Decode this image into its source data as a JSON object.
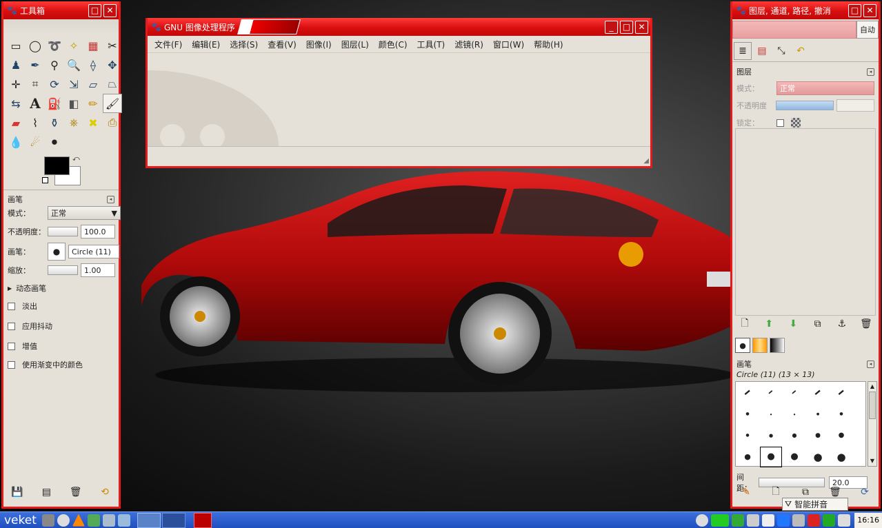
{
  "toolbox": {
    "title": "工具箱",
    "tools": [
      "rect-select",
      "ellipse-select",
      "free-select",
      "fuzzy-select",
      "color-select",
      "scissors",
      "foreground-select",
      "paths",
      "color-picker",
      "zoom",
      "measure",
      "move",
      "align",
      "crop",
      "rotate",
      "scale",
      "shear",
      "perspective",
      "flip",
      "text",
      "bucket-fill",
      "blend",
      "pencil",
      "paintbrush",
      "eraser",
      "airbrush",
      "ink",
      "clone",
      "heal",
      "perspective-clone",
      "blur",
      "smudge",
      "dodge-burn"
    ],
    "tool_options": {
      "header": "画笔",
      "mode_label": "模式：",
      "mode_value": "正常",
      "opacity_label": "不透明度：",
      "opacity_value": "100.0",
      "brush_label": "画笔：",
      "brush_value": "Circle (11)",
      "scale_label": "缩放：",
      "scale_value": "1.00",
      "dynamics_label": "动态画笔",
      "checks": [
        "淡出",
        "应用抖动",
        "增值",
        "使用渐变中的颜色"
      ]
    }
  },
  "main_window": {
    "title": "GNU 图像处理程序",
    "menu": [
      "文件(F)",
      "编辑(E)",
      "选择(S)",
      "查看(V)",
      "图像(I)",
      "图层(L)",
      "颜色(C)",
      "工具(T)",
      "滤镜(R)",
      "窗口(W)",
      "帮助(H)"
    ]
  },
  "dock": {
    "title": "图层, 通道, 路径, 撤消",
    "auto_label": "自动",
    "layers_header": "图层",
    "mode_label": "模式：",
    "mode_value": "正常",
    "opacity_label": "不透明度",
    "lock_label": "锁定：",
    "brushes_header": "画笔",
    "brush_name": "Circle (11) (13 × 13)",
    "spacing_label": "间距：",
    "spacing_value": "20.0",
    "ime_label": "智能拼音"
  },
  "taskbar": {
    "start_label": "veket",
    "clock": "16:16"
  },
  "colors": {
    "accent": "#e51b1b",
    "panel": "#e6e1d8",
    "taskbar": "#1f4fc0"
  }
}
